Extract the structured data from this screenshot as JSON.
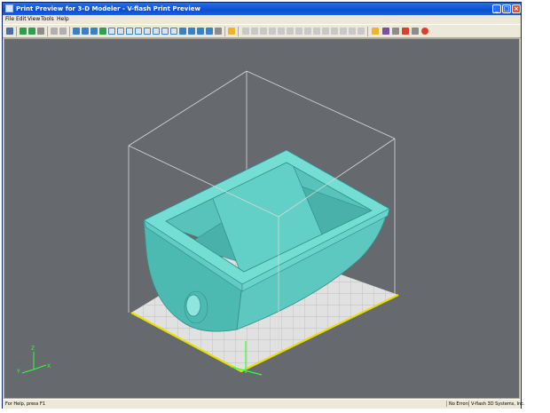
{
  "window": {
    "title": "Print Preview for 3-D Modeler - V-flash Print Preview",
    "min_glyph": "_",
    "max_glyph": "□",
    "close_glyph": "×"
  },
  "menu": {
    "items": [
      "File",
      "Edit",
      "View",
      "Tools",
      "Help"
    ]
  },
  "toolbar": {
    "icon_colors": {
      "view": "#3b82c4",
      "shape": "#2e9e4f",
      "alert": "#d9402b",
      "highlight": "#f0b429",
      "neutral": "#8c8c8c"
    }
  },
  "viewport": {
    "background": "#666a6e",
    "model_color": "#6fd8d0",
    "platform_edge_color": "#e8e000",
    "bounding_box_color": "#d8d8d8",
    "axis_color": "#33ff33",
    "axis_labels": {
      "x": "X",
      "y": "Y",
      "z": "Z"
    }
  },
  "status": {
    "help": "For Help, press F1",
    "errors": "No Errors",
    "vendor": "V-flash 3D Systems, Inc."
  }
}
